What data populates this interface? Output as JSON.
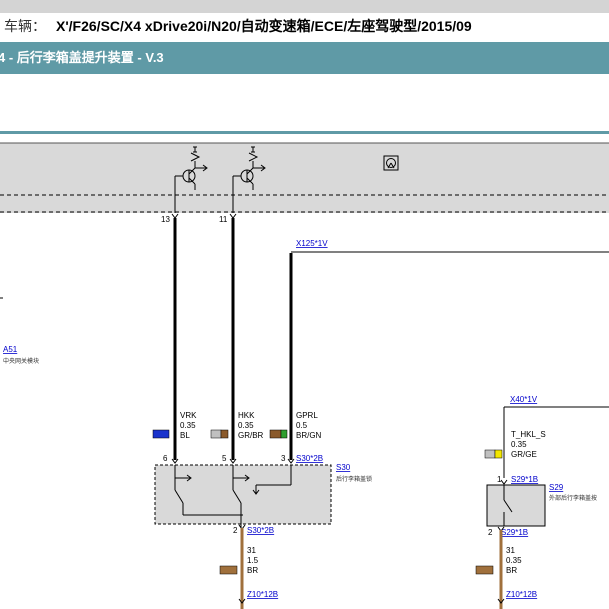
{
  "header": {
    "vehicle_label": "车辆：",
    "vehicle_value": "X'/F26/SC/X4 xDrive20i/N20/自动变速箱/ECE/左座驾驶型/2015/09",
    "title": "4 - 后行李箱盖提升装置 - V.3"
  },
  "colors": {
    "title_bar": "#5f9aa6",
    "module_fill": "#d9d9d9",
    "link_blue": "#0000cc",
    "wire_black": "#000000",
    "wire_brown": "#a0703c"
  },
  "modules": {
    "a51": {
      "code": "A51",
      "name": "中央网关模块"
    },
    "s30": {
      "code": "S30",
      "name": "后行李箱盖锁"
    },
    "s29": {
      "code": "S29",
      "name": "外部后行李箱盖按"
    }
  },
  "connectors": {
    "x125": "X125*1V",
    "x40": "X40*1V",
    "s30_top": "S30*2B",
    "s30_bottom": "S30*2B",
    "s29_top": "S29*1B",
    "s29_bottom": "S29*1B",
    "z10_left": "Z10*12B",
    "z10_right": "Z10*12B"
  },
  "pins": {
    "a51_13": "13",
    "a51_11": "11",
    "s30_6": "6",
    "s30_5": "5",
    "s30_3": "3",
    "s30_2": "2",
    "s29_1": "1",
    "s29_2": "2"
  },
  "wires": {
    "vrk": {
      "signal": "VRK",
      "size": "0.35",
      "color": "BL",
      "swatch": "#1a33cc"
    },
    "hkk": {
      "signal": "HKK",
      "size": "0.35",
      "color": "GR/BR",
      "swatch": "#8a5a2b"
    },
    "gprl": {
      "signal": "GPRL",
      "size": "0.5",
      "color": "BR/GN",
      "swatch": "#8a5a2b"
    },
    "thkl": {
      "signal": "T_HKL_S",
      "size": "0.35",
      "color": "GR/GE",
      "swatch": "#f2e600"
    },
    "gnd_left": {
      "signal": "31",
      "size": "1.5",
      "color": "BR",
      "swatch": "#a0703c"
    },
    "gnd_right": {
      "signal": "31",
      "size": "0.35",
      "color": "BR",
      "swatch": "#a0703c"
    }
  }
}
